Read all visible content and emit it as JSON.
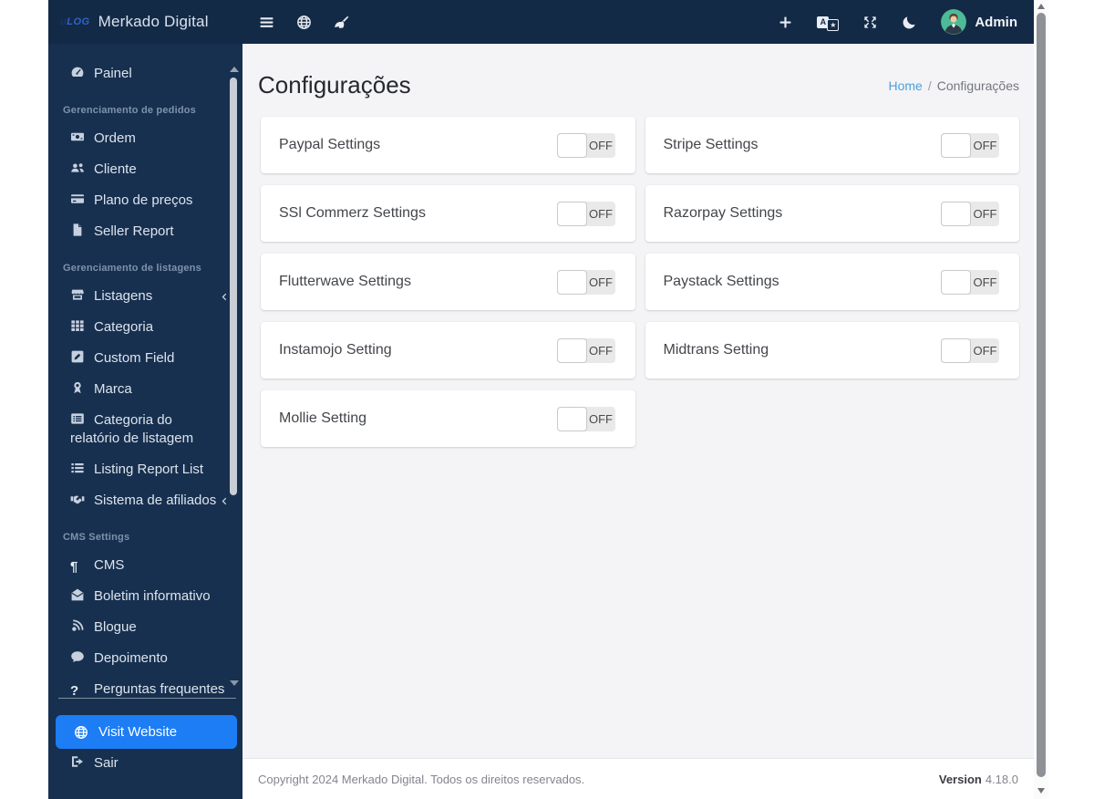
{
  "brand": {
    "logo_text_1": "u",
    "logo_text_2": "LOG",
    "title": "Merkado Digital"
  },
  "navbar": {
    "left_icons": [
      {
        "name": "menu-toggle-icon",
        "icon": "bars"
      },
      {
        "name": "site-globe-icon",
        "icon": "globe"
      },
      {
        "name": "clear-cache-broom-icon",
        "icon": "broom"
      }
    ],
    "right_icons": [
      {
        "name": "add-new-icon",
        "icon": "plus"
      },
      {
        "name": "translate-language-icon",
        "icon": "language"
      },
      {
        "name": "fullscreen-icon",
        "icon": "expand"
      },
      {
        "name": "dark-mode-moon-icon",
        "icon": "moon"
      }
    ],
    "user_label": "Admin"
  },
  "sidebar": {
    "items": [
      {
        "type": "link",
        "icon": "tachometer",
        "label": "Painel"
      },
      {
        "type": "section",
        "label": "Gerenciamento de pedidos"
      },
      {
        "type": "link",
        "icon": "money-bill",
        "label": "Ordem"
      },
      {
        "type": "link",
        "icon": "users",
        "label": "Cliente"
      },
      {
        "type": "link",
        "icon": "credit-card",
        "label": "Plano de preços"
      },
      {
        "type": "link",
        "icon": "file",
        "label": "Seller Report"
      },
      {
        "type": "section",
        "label": "Gerenciamento de listagens"
      },
      {
        "type": "link",
        "icon": "store",
        "label": "Listagens",
        "chevron": true
      },
      {
        "type": "link",
        "icon": "grid",
        "label": "Categoria"
      },
      {
        "type": "link",
        "icon": "edit",
        "label": "Custom Field"
      },
      {
        "type": "link",
        "icon": "award",
        "label": "Marca"
      },
      {
        "type": "link",
        "icon": "list-alt",
        "label": "Categoria do relatório de listagem",
        "two_line": true
      },
      {
        "type": "link",
        "icon": "list",
        "label": "Listing Report List"
      },
      {
        "type": "link",
        "icon": "handshake",
        "label": "Sistema de afiliados",
        "chevron": true
      },
      {
        "type": "section",
        "label": "CMS Settings"
      },
      {
        "type": "link",
        "icon": "paragraph",
        "label": "CMS"
      },
      {
        "type": "link",
        "icon": "envelope-open",
        "label": "Boletim informativo"
      },
      {
        "type": "link",
        "icon": "blog",
        "label": "Blogue"
      },
      {
        "type": "link",
        "icon": "comment",
        "label": "Depoimento"
      },
      {
        "type": "link",
        "icon": "question",
        "label": "Perguntas frequentes"
      }
    ],
    "visit_website_label": "Visit Website",
    "logout_label": "Sair"
  },
  "page": {
    "title": "Configurações",
    "breadcrumb_home": "Home",
    "breadcrumb_separator": "/",
    "breadcrumb_current": "Configurações"
  },
  "settings_cards": [
    {
      "label": "Paypal Settings",
      "state": "OFF"
    },
    {
      "label": "Stripe Settings",
      "state": "OFF"
    },
    {
      "label": "SSl Commerz Settings",
      "state": "OFF"
    },
    {
      "label": "Razorpay Settings",
      "state": "OFF"
    },
    {
      "label": "Flutterwave Settings",
      "state": "OFF"
    },
    {
      "label": "Paystack Settings",
      "state": "OFF"
    },
    {
      "label": "Instamojo Setting",
      "state": "OFF"
    },
    {
      "label": "Midtrans Setting",
      "state": "OFF"
    },
    {
      "label": "Mollie Setting",
      "state": "OFF"
    }
  ],
  "footer": {
    "copyright": "Copyright 2024 Merkado Digital. Todos os direitos reservados.",
    "version_label": "Version",
    "version_value": "4.18.0"
  },
  "colors": {
    "sidebar_bg": "#17304f",
    "navbar_bg": "#132a47",
    "accent_blue": "#1d7df5",
    "link_blue": "#4aa0dc",
    "content_bg": "#f4f4f7",
    "toggle_track": "#e9e9e9"
  }
}
